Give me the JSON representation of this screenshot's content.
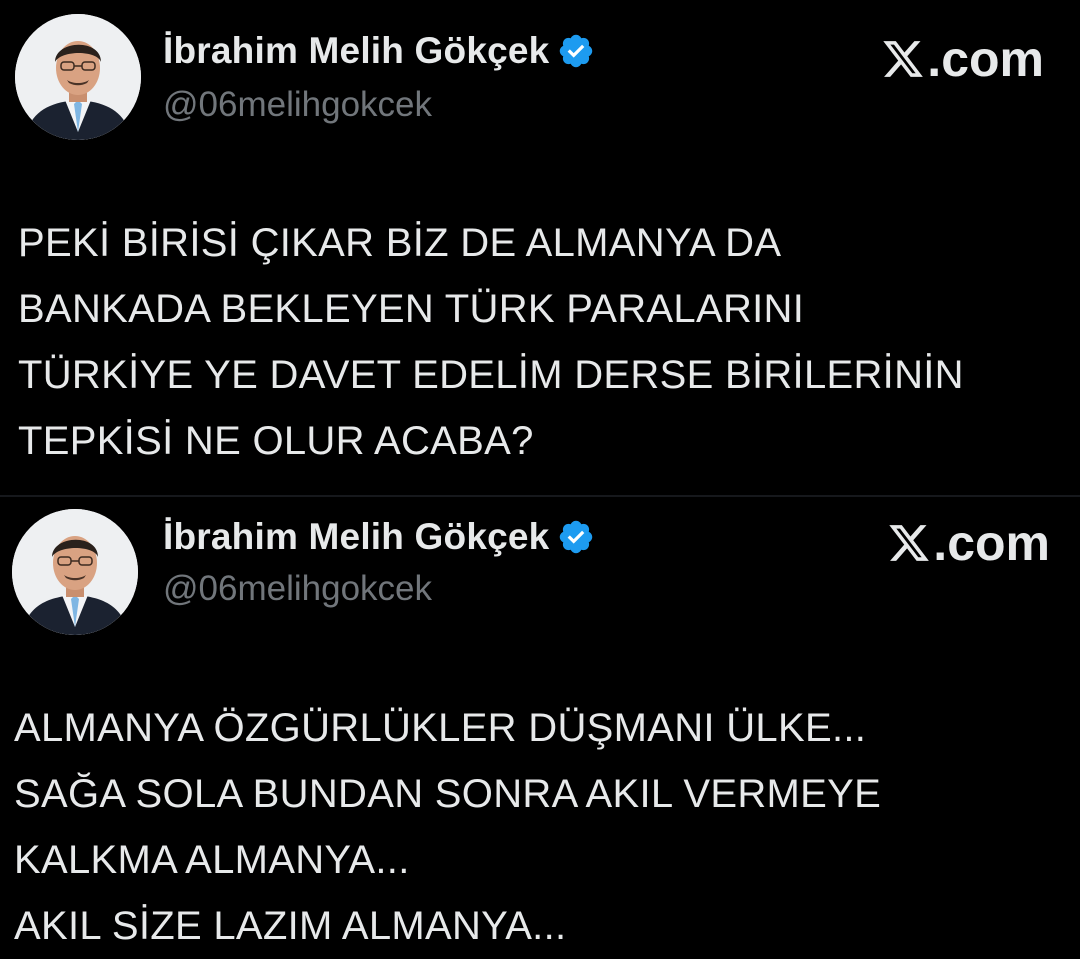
{
  "colors": {
    "background": "#000000",
    "text": "#e7e9ea",
    "muted": "#71767b",
    "verified": "#1d9bf0"
  },
  "icons": {
    "verified": "verified-badge-icon",
    "brand": "x-logo-icon"
  },
  "tweets": [
    {
      "author": {
        "display_name": "İbrahim Melih Gökçek",
        "handle": "@06melihgokcek",
        "verified": true
      },
      "brand": ".com",
      "lines": [
        "PEKİ BİRİSİ ÇIKAR BİZ DE ALMANYA DA",
        "BANKADA BEKLEYEN TÜRK PARALARINI",
        "TÜRKİYE YE DAVET EDELİM DERSE BİRİLERİNİN",
        "TEPKİSİ NE OLUR ACABA?"
      ]
    },
    {
      "author": {
        "display_name": "İbrahim Melih Gökçek",
        "handle": "@06melihgokcek",
        "verified": true
      },
      "brand": ".com",
      "lines": [
        "ALMANYA ÖZGÜRLÜKLER DÜŞMANI ÜLKE...",
        "SAĞA SOLA BUNDAN SONRA AKIL VERMEYE",
        "KALKMA ALMANYA...",
        "AKIL SİZE LAZIM ALMANYA..."
      ]
    }
  ]
}
